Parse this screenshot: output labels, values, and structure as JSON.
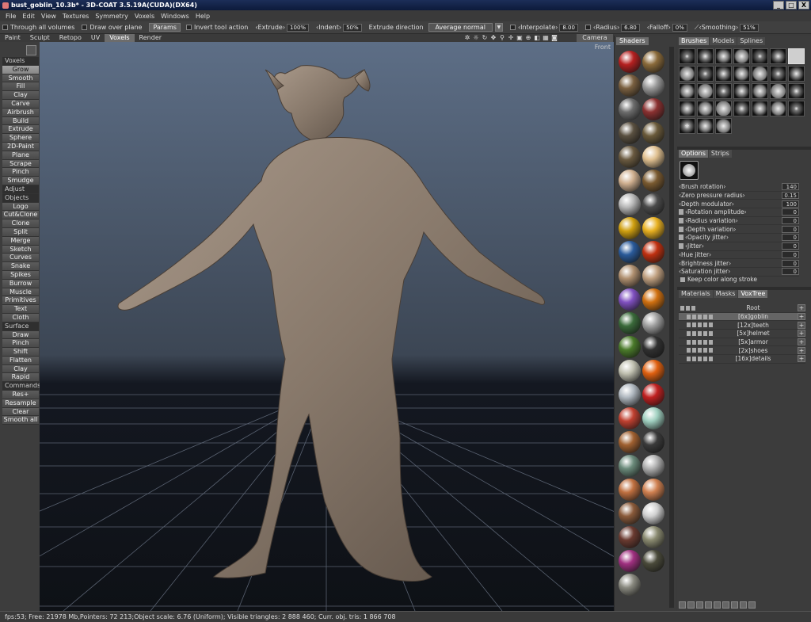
{
  "window": {
    "title": "bust_goblin_10.3b* - 3D-COAT 3.5.19A(CUDA)(DX64)",
    "controls": [
      "_",
      "□",
      "X"
    ]
  },
  "menu": [
    "File",
    "Edit",
    "View",
    "Textures",
    "Symmetry",
    "Voxels",
    "Windows",
    "Help"
  ],
  "toolbar": {
    "through_all_volumes": "Through all volumes",
    "draw_over_plane": "Draw over plane",
    "params": "Params",
    "invert_tool_action": "Invert tool action",
    "extrude_label": "‹Extrude›",
    "extrude_value": "100%",
    "indent_label": "‹Indent›",
    "indent_value": "50%",
    "extrude_direction": "Extrude direction",
    "direction_value": "Average normal",
    "interpolate_label": "‹Interpolate›",
    "interpolate_value": "8.00",
    "radius_label": "‹Radius›",
    "radius_value": "6.80",
    "falloff_label": "‹Falloff›",
    "falloff_value": "0%",
    "smoothing_label": "‹Smoothing›",
    "smoothing_value": "51%"
  },
  "rooms": [
    "Paint",
    "Sculpt",
    "Retopo",
    "UV",
    "Voxels",
    "Render"
  ],
  "active_room": "Voxels",
  "camera_tab": "Camera",
  "view_icons": [
    "gear-icon",
    "sun-icon",
    "rotate-icon",
    "move-icon",
    "zoom-icon",
    "cross-icon",
    "frame-icon",
    "zoom-in-icon",
    "cube-icon",
    "cube-icon",
    "grid-icon",
    "camera-icon"
  ],
  "viewport": {
    "view_label": "Front"
  },
  "tools": [
    {
      "label": "Voxels",
      "type": "hdr"
    },
    {
      "label": "Grow",
      "type": "sel"
    },
    {
      "label": "Smooth"
    },
    {
      "label": "Fill"
    },
    {
      "label": "Clay"
    },
    {
      "label": "Carve"
    },
    {
      "label": "Airbrush"
    },
    {
      "label": "Build"
    },
    {
      "label": "Extrude"
    },
    {
      "label": "Sphere"
    },
    {
      "label": "2D-Paint"
    },
    {
      "label": "Plane"
    },
    {
      "label": "Scrape"
    },
    {
      "label": "Pinch"
    },
    {
      "label": "Smudge"
    },
    {
      "label": "Adjust",
      "type": "hdr"
    },
    {
      "label": "Objects",
      "type": "hdr"
    },
    {
      "label": "Logo"
    },
    {
      "label": "Cut&Clone"
    },
    {
      "label": "Clone"
    },
    {
      "label": "Split"
    },
    {
      "label": "Merge"
    },
    {
      "label": "Sketch"
    },
    {
      "label": "Curves"
    },
    {
      "label": "Snake"
    },
    {
      "label": "Spikes"
    },
    {
      "label": "Burrow"
    },
    {
      "label": "Muscle"
    },
    {
      "label": "Primitives"
    },
    {
      "label": "Text"
    },
    {
      "label": "Cloth"
    },
    {
      "label": "Surface",
      "type": "hdr"
    },
    {
      "label": "Draw"
    },
    {
      "label": "Pinch"
    },
    {
      "label": "Shift"
    },
    {
      "label": "Flatten"
    },
    {
      "label": "Clay"
    },
    {
      "label": "Rapid"
    },
    {
      "label": "Commands",
      "type": "hdr"
    },
    {
      "label": "Res+"
    },
    {
      "label": "Resample"
    },
    {
      "label": "Clear"
    },
    {
      "label": "Smooth all"
    }
  ],
  "shaders": {
    "tab": "Shaders",
    "swatches": [
      "#b52020",
      "#8a6a3a",
      "#7a6040",
      "#9a9a9a",
      "#6c6c6c",
      "#8a3030",
      "#5a5040",
      "#6a5a3a",
      "#6a5a40",
      "#e0c090",
      "#d0b090",
      "#7a5a30",
      "#b8b8b8",
      "#4a4a4a",
      "#d0a010",
      "#e8b020",
      "#2a5a9a",
      "#c03010",
      "#b09070",
      "#c0a080",
      "#8050c0",
      "#d07010",
      "#3a6a3a",
      "#a0a0a0",
      "#4a7a2a",
      "#303030",
      "#c0c0b0",
      "#e06010",
      "#b0b8c0",
      "#c02020",
      "#c04030",
      "#a0d0c0",
      "#a06030",
      "#3a3a3a",
      "#6a8a7a",
      "#b0b0b0",
      "#c07040",
      "#d08050",
      "#8a5a3a",
      "#d0d0d0",
      "#6a3a30",
      "#8a8a70",
      "#a03080",
      "#4a4a3a",
      "#8a8a80"
    ]
  },
  "brushes": {
    "tabs": [
      "Brushes",
      "Models",
      "Splines"
    ],
    "active": "Brushes",
    "cells": [
      "",
      "",
      "",
      "",
      "",
      "",
      "",
      "",
      "",
      "",
      "",
      "",
      "",
      "",
      "",
      "",
      "",
      "",
      "",
      "",
      "",
      "",
      "",
      "",
      "",
      "",
      "",
      "",
      "+",
      "",
      ""
    ]
  },
  "options": {
    "tabs": [
      "Options",
      "Strips"
    ],
    "active": "Options",
    "rows": [
      {
        "label": "‹Brush rotation›",
        "value": "140",
        "lock": false
      },
      {
        "label": "‹Zero pressure radius›",
        "value": "0.15",
        "lock": false
      },
      {
        "label": "‹Depth modulator›",
        "value": "100",
        "lock": false
      },
      {
        "label": "‹Rotation amplitude›",
        "value": "0",
        "lock": true
      },
      {
        "label": "‹Radius variation›",
        "value": "0",
        "lock": true
      },
      {
        "label": "‹Depth variation›",
        "value": "0",
        "lock": true
      },
      {
        "label": "‹Opacity jitter›",
        "value": "0",
        "lock": true
      },
      {
        "label": "‹Jitter›",
        "value": "0",
        "lock": true
      },
      {
        "label": "‹Hue jitter›",
        "value": "0",
        "lock": false
      },
      {
        "label": "‹Brightness jitter›",
        "value": "0",
        "lock": false
      },
      {
        "label": "‹Saturation jitter›",
        "value": "0",
        "lock": false
      }
    ],
    "keep_color": "Keep color along stroke"
  },
  "voxtree": {
    "tabs": [
      "Materials",
      "Masks",
      "VoxTree"
    ],
    "active": "VoxTree",
    "rows": [
      {
        "name": "Root",
        "selected": false
      },
      {
        "name": "[6x]goblin",
        "selected": true
      },
      {
        "name": "[12x]teeth",
        "selected": false
      },
      {
        "name": "[5x]helmet",
        "selected": false
      },
      {
        "name": "[5x]armor",
        "selected": false
      },
      {
        "name": "[2x]shoes",
        "selected": false
      },
      {
        "name": "[16x]details",
        "selected": false
      }
    ]
  },
  "status": "fps:53;     Free: 21978 Mb,Pointers: 72 213;Object scale: 6.76 (Uniform); Visible triangles: 2 888 460; Curr. obj. tris: 1 866 708"
}
